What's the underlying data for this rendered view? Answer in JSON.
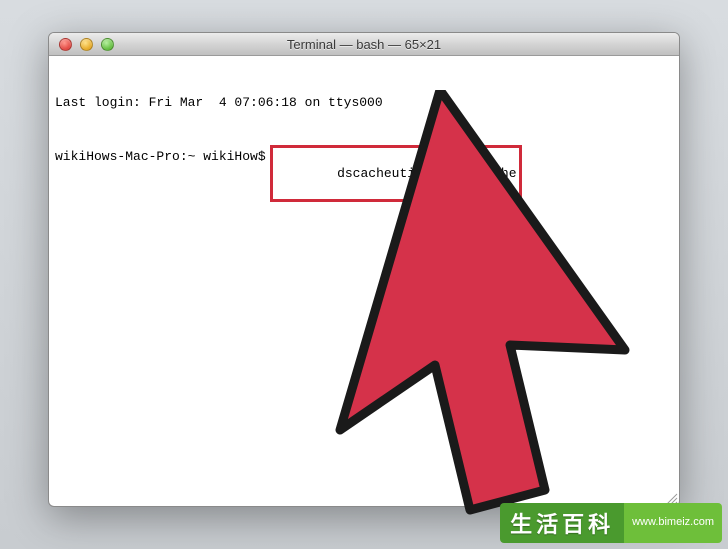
{
  "window": {
    "title": "Terminal — bash — 65×21"
  },
  "terminal": {
    "login_line": "Last login: Fri Mar  4 07:06:18 on ttys000",
    "prompt": "wikiHows-Mac-Pro:~ wikiHow$",
    "command": "dscacheutil -flushcache"
  },
  "watermark": {
    "title": "生活百科",
    "url": "www.bimeiz.com"
  },
  "colors": {
    "highlight_border": "#d02a3a",
    "cursor_fill": "#d5324a",
    "cursor_stroke": "#1a1a1a"
  }
}
